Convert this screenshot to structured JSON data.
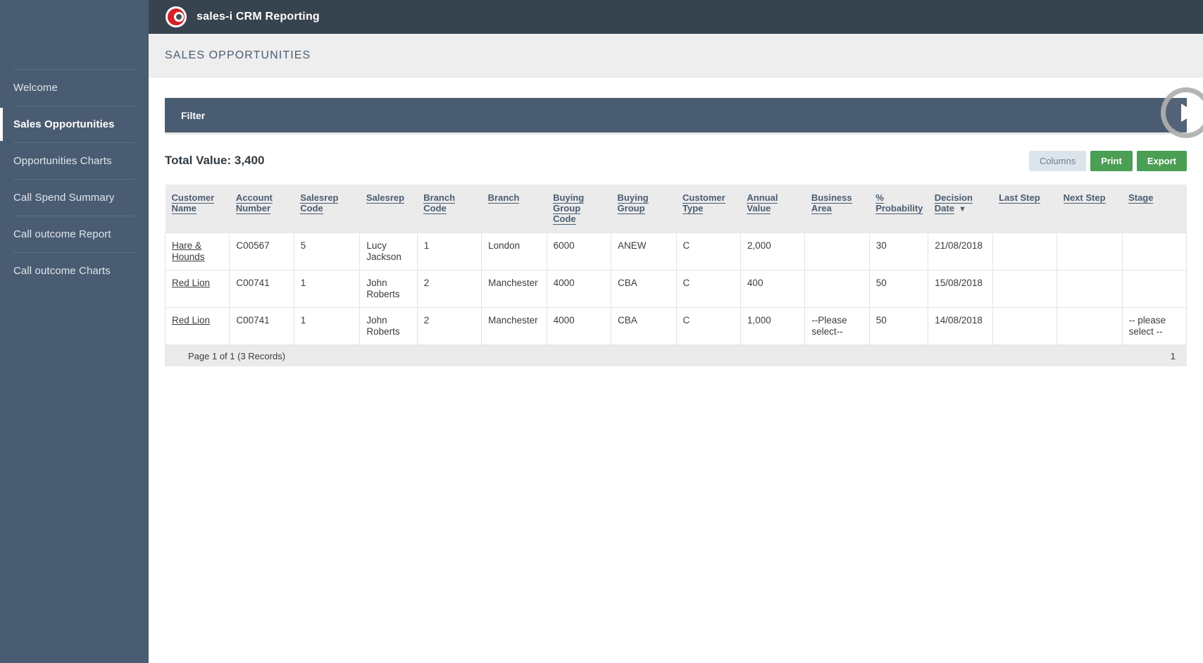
{
  "app": {
    "title": "sales-i CRM Reporting",
    "logo_icon": "sales-i-logo-icon"
  },
  "sidebar": {
    "items": [
      {
        "label": "Welcome",
        "active": false
      },
      {
        "label": "Sales Opportunities",
        "active": true
      },
      {
        "label": "Opportunities Charts",
        "active": false
      },
      {
        "label": "Call Spend Summary",
        "active": false
      },
      {
        "label": "Call outcome Report",
        "active": false
      },
      {
        "label": "Call outcome Charts",
        "active": false
      }
    ]
  },
  "page": {
    "title": "SALES OPPORTUNITIES"
  },
  "filter": {
    "label": "Filter"
  },
  "play_overlay": {
    "icon": "play-icon"
  },
  "summary": {
    "total_value_label": "Total Value: 3,400"
  },
  "toolbar": {
    "columns_label": "Columns",
    "print_label": "Print",
    "export_label": "Export"
  },
  "table": {
    "columns": [
      {
        "label": "Customer Name",
        "sorted": false
      },
      {
        "label": "Account Number",
        "sorted": false
      },
      {
        "label": "Salesrep Code",
        "sorted": false
      },
      {
        "label": "Salesrep",
        "sorted": false
      },
      {
        "label": "Branch Code",
        "sorted": false
      },
      {
        "label": "Branch",
        "sorted": false
      },
      {
        "label": "Buying Group Code",
        "sorted": false
      },
      {
        "label": "Buying Group",
        "sorted": false
      },
      {
        "label": "Customer Type",
        "sorted": false
      },
      {
        "label": "Annual Value",
        "sorted": false
      },
      {
        "label": "Business Area",
        "sorted": false
      },
      {
        "label": "% Probability",
        "sorted": false
      },
      {
        "label": "Decision Date",
        "sorted": true,
        "sort_arrow": "▼"
      },
      {
        "label": "Last Step",
        "sorted": false
      },
      {
        "label": "Next Step",
        "sorted": false
      },
      {
        "label": "Stage",
        "sorted": false
      }
    ],
    "rows": [
      {
        "customer_name": "Hare & Hounds",
        "account_number": "C00567",
        "salesrep_code": "5",
        "salesrep": "Lucy Jackson",
        "branch_code": "1",
        "branch": "London",
        "buying_group_code": "6000",
        "buying_group": "ANEW",
        "customer_type": "C",
        "annual_value": "2,000",
        "business_area": "",
        "probability": "30",
        "decision_date": "21/08/2018",
        "last_step": "",
        "next_step": "",
        "stage": ""
      },
      {
        "customer_name": "Red Lion",
        "account_number": "C00741",
        "salesrep_code": "1",
        "salesrep": "John Roberts",
        "branch_code": "2",
        "branch": "Manchester",
        "buying_group_code": "4000",
        "buying_group": "CBA",
        "customer_type": "C",
        "annual_value": "400",
        "business_area": "",
        "probability": "50",
        "decision_date": "15/08/2018",
        "last_step": "",
        "next_step": "",
        "stage": ""
      },
      {
        "customer_name": "Red Lion",
        "account_number": "C00741",
        "salesrep_code": "1",
        "salesrep": "John Roberts",
        "branch_code": "2",
        "branch": "Manchester",
        "buying_group_code": "4000",
        "buying_group": "CBA",
        "customer_type": "C",
        "annual_value": "1,000",
        "business_area": "--Please select--",
        "probability": "50",
        "decision_date": "14/08/2018",
        "last_step": "",
        "next_step": "",
        "stage": "-- please select --"
      }
    ],
    "footer": {
      "records_label": "Page 1 of 1 (3 Records)",
      "current_page": "1"
    }
  },
  "colors": {
    "sidebar_bg": "#4a5c71",
    "topbar_bg": "#37434f",
    "accent_green": "#4a9f54",
    "logo_red": "#d62128",
    "header_text": "#4a5c71"
  }
}
